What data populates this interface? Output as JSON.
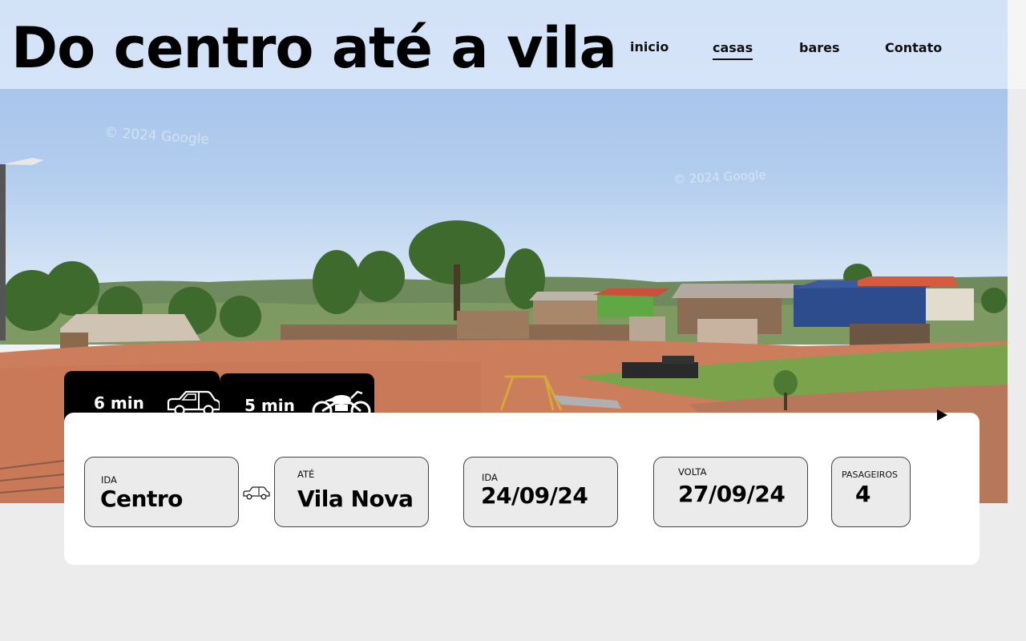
{
  "header": {
    "title": "Do centro até a vila",
    "nav": [
      {
        "label": "inicio",
        "active": false
      },
      {
        "label": "casas",
        "active": true
      },
      {
        "label": "bares",
        "active": false
      },
      {
        "label": "Contato",
        "active": false
      }
    ]
  },
  "hero": {
    "watermark": "© 2024 Google"
  },
  "travel_times": {
    "car": {
      "label": "6 min",
      "icon": "car-icon"
    },
    "motorcycle": {
      "label": "5 min",
      "icon": "motorcycle-icon"
    }
  },
  "booking": {
    "from": {
      "label": "IDA",
      "value": "Centro"
    },
    "to": {
      "label": "ATÉ",
      "value": "Vila Nova"
    },
    "departure": {
      "label": "IDA",
      "value": "24/09/24"
    },
    "return": {
      "label": "VOLTA",
      "value": "27/09/24"
    },
    "passengers": {
      "label": "PASAGEIROS",
      "value": "4"
    },
    "route_icon": "car-icon",
    "submit_icon": "play-icon"
  },
  "colors": {
    "badge_bg": "#000000",
    "card_bg": "#ffffff",
    "field_bg": "#ebebeb",
    "page_bg": "#ececec"
  }
}
